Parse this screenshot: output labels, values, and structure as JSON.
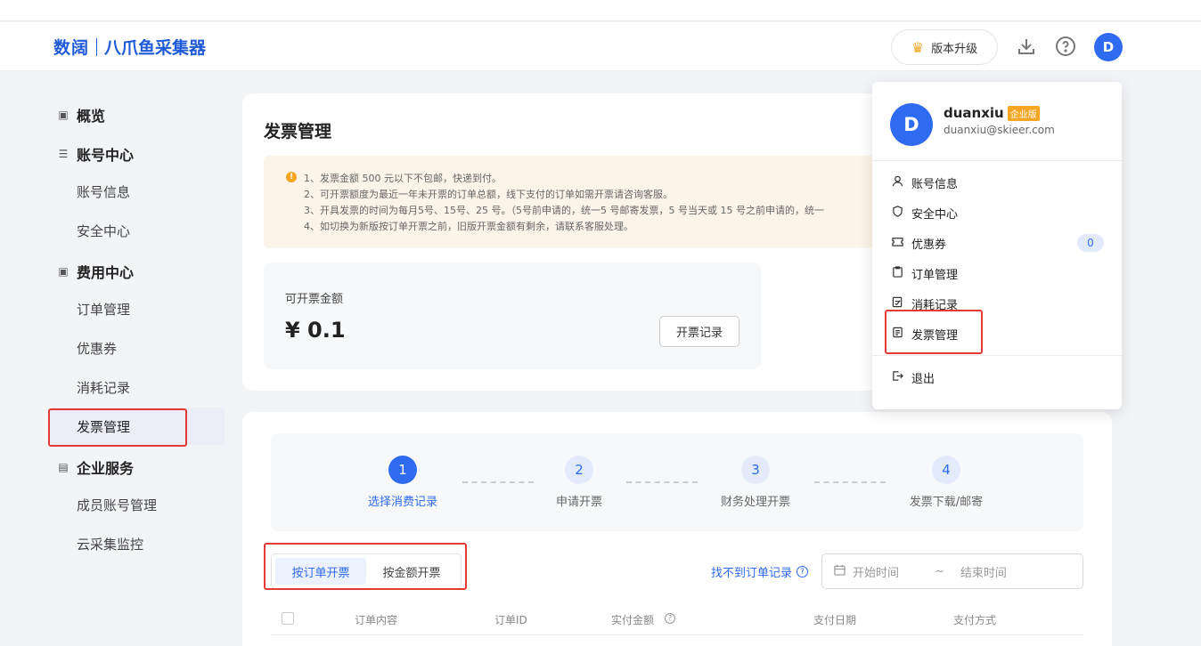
{
  "header": {
    "logo_brand": "数阔",
    "logo_product": "八爪鱼采集器",
    "upgrade_label": "版本升级",
    "avatar_letter": "D",
    "icons": [
      "crown-icon",
      "download-icon",
      "help-icon"
    ]
  },
  "sidebar": {
    "groups": [
      {
        "label": "概览",
        "icon": "overview-icon"
      },
      {
        "label": "账号中心",
        "icon": "account-icon"
      },
      {
        "label": "费用中心",
        "icon": "wallet-icon"
      },
      {
        "label": "企业服务",
        "icon": "enterprise-icon"
      }
    ],
    "items": [
      "账号信息",
      "安全中心",
      "订单管理",
      "优惠券",
      "消耗记录",
      "发票管理",
      "成员账号管理",
      "云采集监控"
    ],
    "active_item": "发票管理"
  },
  "main": {
    "title": "发票管理",
    "notices": [
      "1、发票金额 500 元以下不包邮，快递到付。",
      "2、可开票额度为最近一年未开票的订单总额，线下支付的订单如需开票请咨询客服。",
      "3、开具发票的时间为每月5号、15号、25 号。（5号前申请的，统一5 号邮寄发票，5 号当天或 15 号之前申请的，统一",
      "4、如切换为新版按订单开票之前，旧版开票金额有剩余，请联系客服处理。"
    ],
    "amount_label": "可开票金额",
    "amount_value": "¥ 0.1",
    "record_button": "开票记录",
    "steps": [
      {
        "num": "1",
        "label": "选择消费记录"
      },
      {
        "num": "2",
        "label": "申请开票"
      },
      {
        "num": "3",
        "label": "财务处理开票"
      },
      {
        "num": "4",
        "label": "发票下载/邮寄"
      }
    ],
    "active_step": 1,
    "tabs": [
      "按订单开票",
      "按金额开票"
    ],
    "active_tab": "按订单开票",
    "not_found_link": "找不到订单记录",
    "date_start_placeholder": "开始时间",
    "date_separator": "~",
    "date_end_placeholder": "结束时间",
    "table_headers": [
      "订单内容",
      "订单ID",
      "实付金额",
      "支付日期",
      "支付方式"
    ]
  },
  "dropdown": {
    "avatar_letter": "D",
    "username": "duanxiu",
    "badge": "企业版",
    "email": "duanxiu@skieer.com",
    "items": [
      "账号信息",
      "安全中心",
      "优惠券",
      "订单管理",
      "消耗记录",
      "发票管理"
    ],
    "coupon_count": "0",
    "logout": "退出"
  },
  "colors": {
    "accent": "#2f6bf1",
    "highlight_box": "#e53935",
    "badge": "#f5a623"
  }
}
